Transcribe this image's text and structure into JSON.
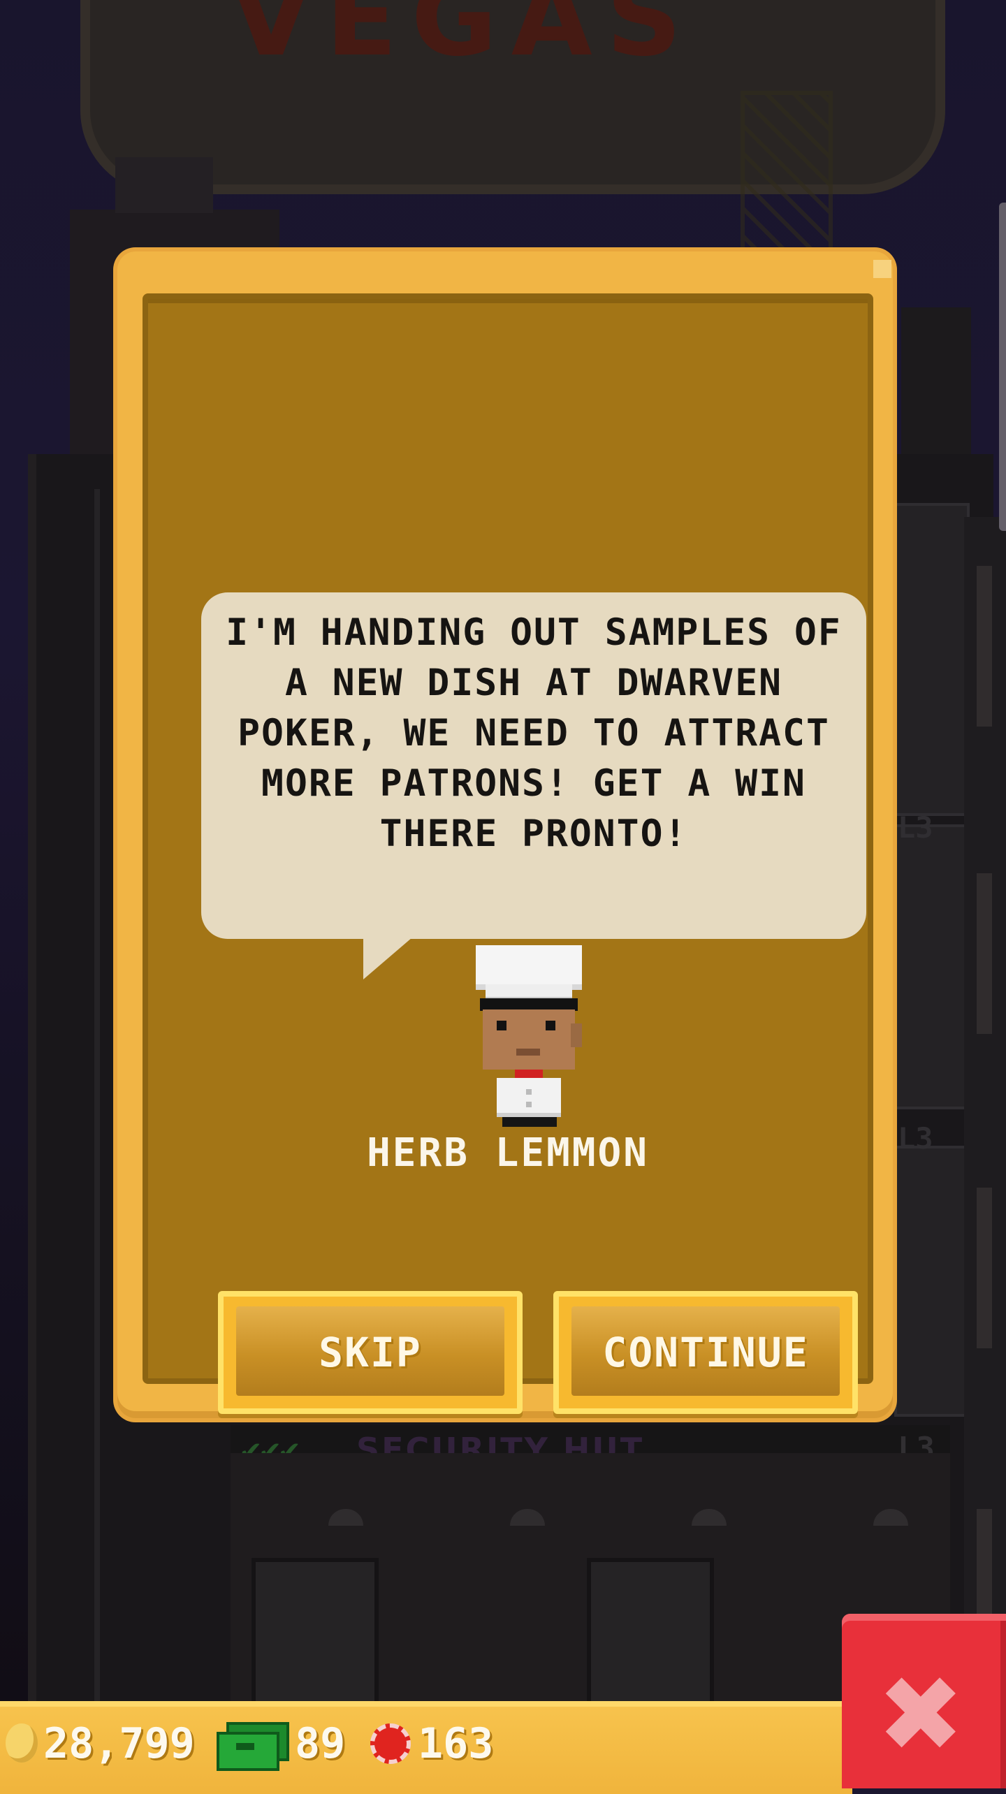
{
  "scene": {
    "sign_text": "VEGAS",
    "side_levels": [
      "L3",
      "L3",
      "L3"
    ],
    "lower_room_title": "SECURITY HUT",
    "lower_room_level": "L3",
    "checkmarks": "✔✔✔"
  },
  "dialog": {
    "message": "I'M HANDING OUT SAMPLES OF A NEW DISH AT DWARVEN POKER, WE NEED TO ATTRACT MORE PATRONS! GET A WIN THERE PRONTO!",
    "character_name": "HERB LEMMON",
    "character_icon": "chef-avatar",
    "buttons": {
      "skip": "SKIP",
      "continue": "CONTINUE"
    }
  },
  "hud": {
    "coins": "28,799",
    "bux": "89",
    "chips": "163",
    "close_icon": "close-x-icon"
  },
  "colors": {
    "dialog_frame": "#f1b545",
    "dialog_panel": "#a37516",
    "bubble": "#e6dac0",
    "close_button": "#e8303a"
  }
}
